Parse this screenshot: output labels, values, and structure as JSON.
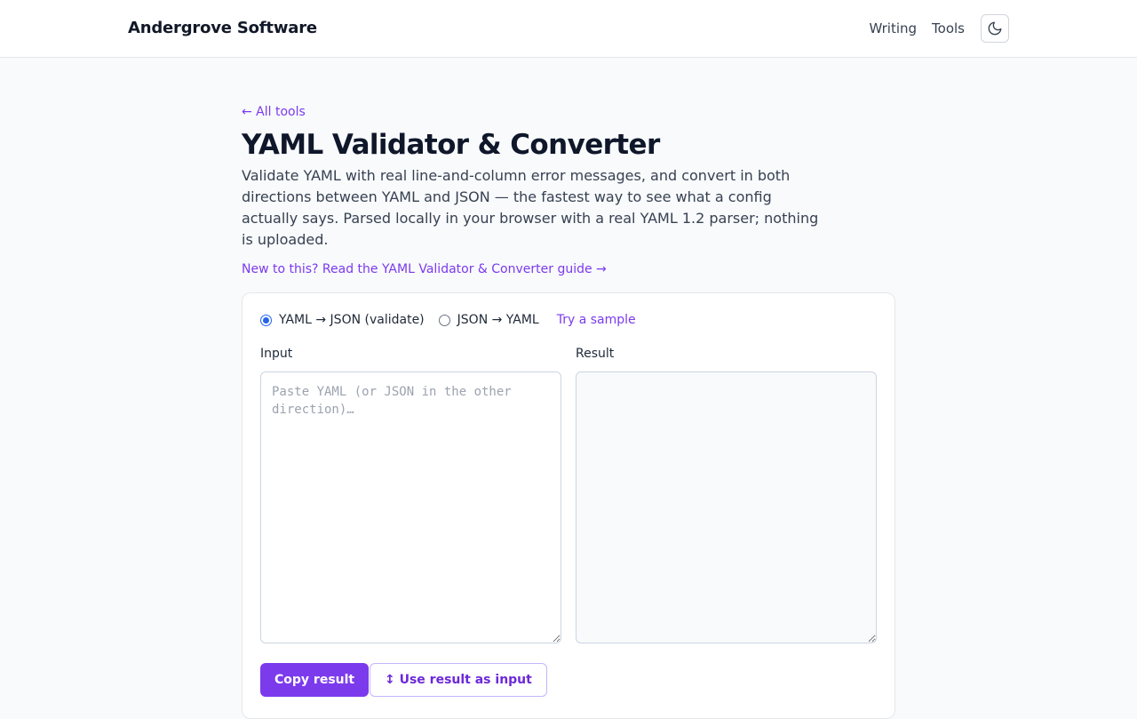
{
  "header": {
    "brand": "Andergrove Software",
    "nav": [
      {
        "label": "Writing"
      },
      {
        "label": "Tools"
      }
    ],
    "theme_icon": "moon-icon"
  },
  "page": {
    "back_link": "← All tools",
    "title": "YAML Validator & Converter",
    "description": "Validate YAML with real line-and-column error messages, and convert in both directions between YAML and JSON — the fastest way to see what a config actually says. Parsed locally in your browser with a real YAML 1.2 parser; nothing is uploaded.",
    "guide_link": "New to this? Read the YAML Validator & Converter guide →"
  },
  "tool": {
    "modes": [
      {
        "label": "YAML → JSON (validate)",
        "selected": true
      },
      {
        "label": "JSON → YAML",
        "selected": false
      }
    ],
    "sample_link": "Try a sample",
    "input_label": "Input",
    "input_placeholder": "Paste YAML (or JSON in the other direction)…",
    "input_value": "",
    "result_label": "Result",
    "result_value": "",
    "copy_button": "Copy result",
    "use_result_button": "↕ Use result as input"
  },
  "colors": {
    "accent": "#7c3aed",
    "radio_selected": "#2563eb",
    "background": "#f8fafc"
  }
}
